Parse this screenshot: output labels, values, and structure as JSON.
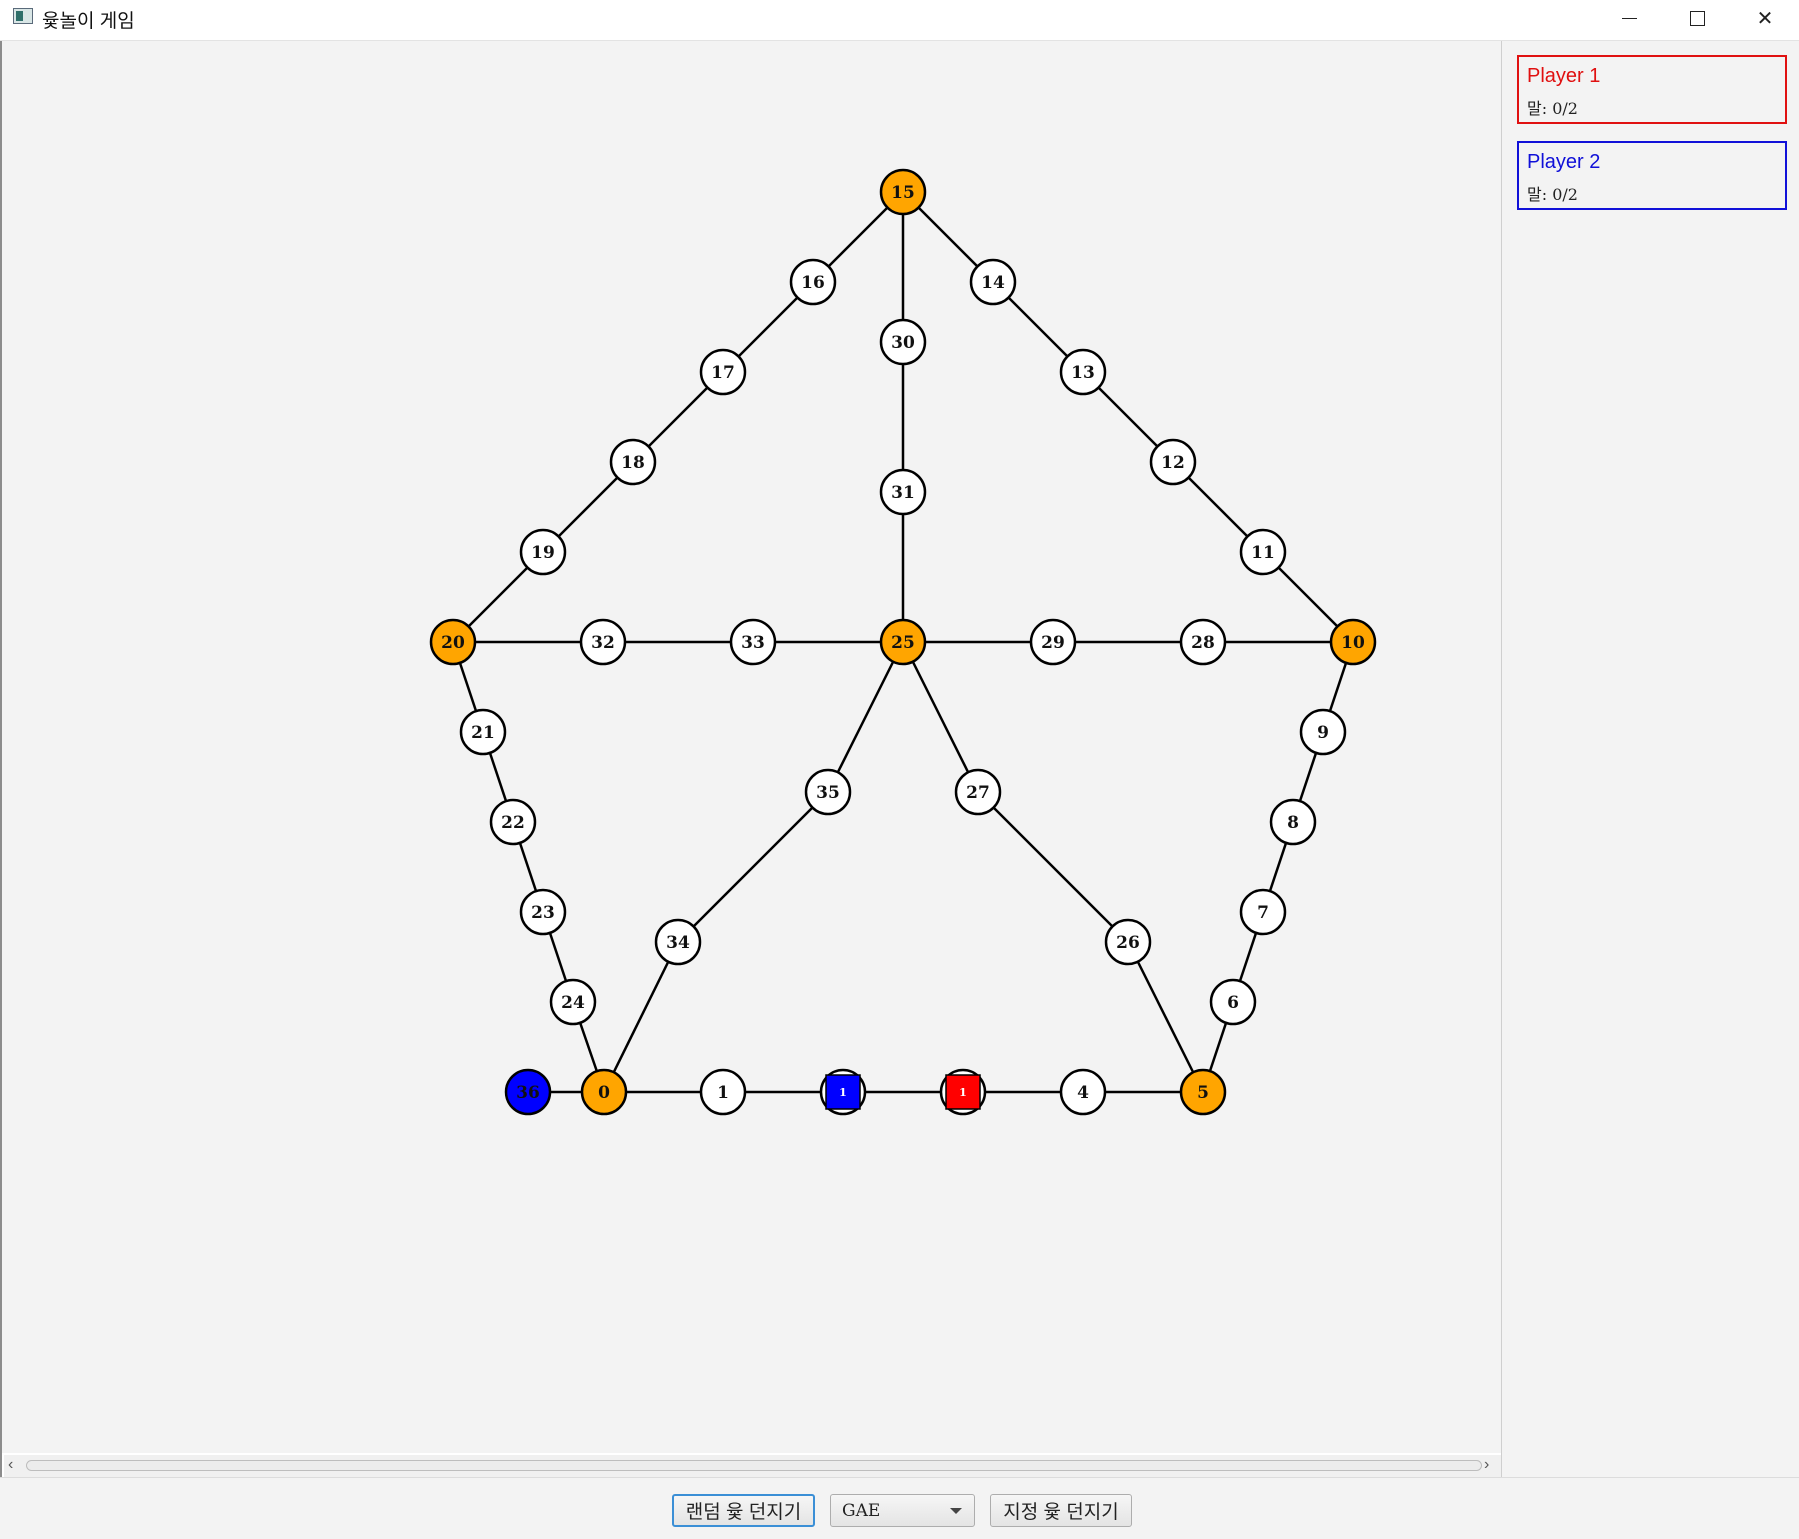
{
  "window": {
    "title": "윷놀이 게임"
  },
  "board": {
    "edges": [
      [
        0,
        1
      ],
      [
        1,
        2
      ],
      [
        2,
        3
      ],
      [
        3,
        4
      ],
      [
        4,
        5
      ],
      [
        5,
        6
      ],
      [
        6,
        7
      ],
      [
        7,
        8
      ],
      [
        8,
        9
      ],
      [
        9,
        10
      ],
      [
        10,
        11
      ],
      [
        11,
        12
      ],
      [
        12,
        13
      ],
      [
        13,
        14
      ],
      [
        14,
        15
      ],
      [
        15,
        16
      ],
      [
        16,
        17
      ],
      [
        17,
        18
      ],
      [
        18,
        19
      ],
      [
        19,
        20
      ],
      [
        20,
        21
      ],
      [
        21,
        22
      ],
      [
        22,
        23
      ],
      [
        23,
        24
      ],
      [
        24,
        0
      ],
      [
        0,
        "36"
      ],
      [
        10,
        28
      ],
      [
        28,
        29
      ],
      [
        29,
        25
      ],
      [
        20,
        32
      ],
      [
        32,
        33
      ],
      [
        33,
        25
      ],
      [
        15,
        30
      ],
      [
        30,
        31
      ],
      [
        31,
        25
      ],
      [
        25,
        27
      ],
      [
        27,
        26
      ],
      [
        26,
        5
      ],
      [
        25,
        35
      ],
      [
        35,
        34
      ],
      [
        34,
        0
      ]
    ],
    "nodes": [
      {
        "id": "0",
        "label": "0",
        "type": "corner"
      },
      {
        "id": "1",
        "label": "1",
        "type": "normal"
      },
      {
        "id": "2",
        "label": "2",
        "type": "normal",
        "piece": {
          "player": "Player 2",
          "count": "1",
          "color": "#0000ff"
        }
      },
      {
        "id": "3",
        "label": "3",
        "type": "normal",
        "piece": {
          "player": "Player 1",
          "count": "1",
          "color": "#ff0000"
        }
      },
      {
        "id": "4",
        "label": "4",
        "type": "normal"
      },
      {
        "id": "5",
        "label": "5",
        "type": "corner"
      },
      {
        "id": "6",
        "label": "6",
        "type": "normal"
      },
      {
        "id": "7",
        "label": "7",
        "type": "normal"
      },
      {
        "id": "8",
        "label": "8",
        "type": "normal"
      },
      {
        "id": "9",
        "label": "9",
        "type": "normal"
      },
      {
        "id": "10",
        "label": "10",
        "type": "corner"
      },
      {
        "id": "11",
        "label": "11",
        "type": "normal"
      },
      {
        "id": "12",
        "label": "12",
        "type": "normal"
      },
      {
        "id": "13",
        "label": "13",
        "type": "normal"
      },
      {
        "id": "14",
        "label": "14",
        "type": "normal"
      },
      {
        "id": "15",
        "label": "15",
        "type": "corner"
      },
      {
        "id": "16",
        "label": "16",
        "type": "normal"
      },
      {
        "id": "17",
        "label": "17",
        "type": "normal"
      },
      {
        "id": "18",
        "label": "18",
        "type": "normal"
      },
      {
        "id": "19",
        "label": "19",
        "type": "normal"
      },
      {
        "id": "20",
        "label": "20",
        "type": "corner"
      },
      {
        "id": "21",
        "label": "21",
        "type": "normal"
      },
      {
        "id": "22",
        "label": "22",
        "type": "normal"
      },
      {
        "id": "23",
        "label": "23",
        "type": "normal"
      },
      {
        "id": "24",
        "label": "24",
        "type": "normal"
      },
      {
        "id": "25",
        "label": "25",
        "type": "corner"
      },
      {
        "id": "26",
        "label": "26",
        "type": "normal"
      },
      {
        "id": "27",
        "label": "27",
        "type": "normal"
      },
      {
        "id": "28",
        "label": "28",
        "type": "normal"
      },
      {
        "id": "29",
        "label": "29",
        "type": "normal"
      },
      {
        "id": "30",
        "label": "30",
        "type": "normal"
      },
      {
        "id": "31",
        "label": "31",
        "type": "normal"
      },
      {
        "id": "32",
        "label": "32",
        "type": "normal"
      },
      {
        "id": "33",
        "label": "33",
        "type": "normal"
      },
      {
        "id": "34",
        "label": "34",
        "type": "normal"
      },
      {
        "id": "35",
        "label": "35",
        "type": "normal"
      },
      {
        "id": "36",
        "label": "36",
        "type": "goal"
      }
    ],
    "colors": {
      "corner": "#ffa500",
      "normal": "#ffffff",
      "goal": "#0000ff",
      "edge": "#000000",
      "background": "#f3f3f3"
    }
  },
  "players": [
    {
      "name": "Player 1",
      "pieces": "말: 0/2",
      "color": "#e01010"
    },
    {
      "name": "Player 2",
      "pieces": "말: 0/2",
      "color": "#1010d8"
    }
  ],
  "controls": {
    "random_throw_label": "랜덤 윷 던지기",
    "throw_select_value": "GAE",
    "specified_throw_label": "지정 윷 던지기"
  },
  "icons": {
    "app": "app-window-icon",
    "minimize": "minimize-icon",
    "maximize": "maximize-icon",
    "close": "close-icon"
  }
}
